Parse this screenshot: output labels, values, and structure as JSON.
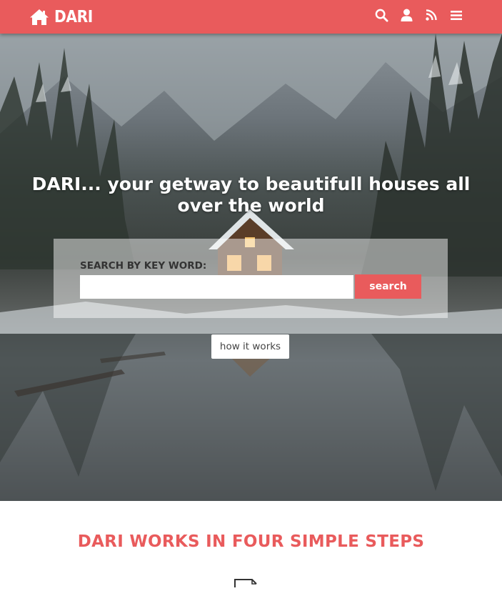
{
  "brand": {
    "name": "DARI",
    "icon": "home-icon"
  },
  "nav": {
    "icons": [
      "search-icon",
      "user-icon",
      "rss-icon",
      "menu-icon"
    ]
  },
  "hero": {
    "title": "DARI... your getway to beautifull houses all over the world"
  },
  "search": {
    "label": "SEARCH BY KEY WORD:",
    "input_value": "",
    "placeholder": "",
    "button_label": "search"
  },
  "how_it_works": {
    "label": "how it works"
  },
  "steps": {
    "heading": "DARI WORKS IN FOUR SIMPLE STEPS",
    "first_icon": "edit-note-icon"
  },
  "colors": {
    "accent": "#e95b5c",
    "nav_text": "#ffffff",
    "panel_text": "#333333"
  }
}
